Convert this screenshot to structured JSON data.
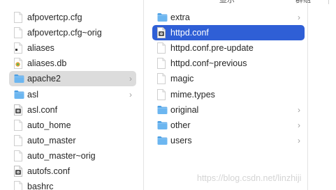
{
  "header": {
    "left_label": "显示",
    "right_label": "群组"
  },
  "left_column": {
    "items": [
      {
        "label": "afpovertcp.cfg",
        "icon": "document-icon",
        "has_children": false
      },
      {
        "label": "afpovertcp.cfg~orig",
        "icon": "document-icon",
        "has_children": false
      },
      {
        "label": "aliases",
        "icon": "executable-document-icon",
        "has_children": false
      },
      {
        "label": "aliases.db",
        "icon": "database-document-icon",
        "has_children": false
      },
      {
        "label": "apache2",
        "icon": "folder-icon",
        "has_children": true,
        "selected": true
      },
      {
        "label": "asl",
        "icon": "folder-icon",
        "has_children": true
      },
      {
        "label": "asl.conf",
        "icon": "config-document-icon",
        "has_children": false
      },
      {
        "label": "auto_home",
        "icon": "document-icon",
        "has_children": false
      },
      {
        "label": "auto_master",
        "icon": "document-icon",
        "has_children": false
      },
      {
        "label": "auto_master~orig",
        "icon": "document-icon",
        "has_children": false
      },
      {
        "label": "autofs.conf",
        "icon": "config-document-icon",
        "has_children": false
      },
      {
        "label": "bashrc",
        "icon": "document-icon",
        "has_children": false
      }
    ]
  },
  "right_column": {
    "items": [
      {
        "label": "extra",
        "icon": "folder-icon",
        "has_children": true
      },
      {
        "label": "httpd.conf",
        "icon": "config-document-icon",
        "has_children": false,
        "selected": true
      },
      {
        "label": "httpd.conf.pre-update",
        "icon": "document-icon",
        "has_children": false
      },
      {
        "label": "httpd.conf~previous",
        "icon": "document-icon",
        "has_children": false
      },
      {
        "label": "magic",
        "icon": "document-icon",
        "has_children": false
      },
      {
        "label": "mime.types",
        "icon": "document-icon",
        "has_children": false
      },
      {
        "label": "original",
        "icon": "folder-icon",
        "has_children": true
      },
      {
        "label": "other",
        "icon": "folder-icon",
        "has_children": true
      },
      {
        "label": "users",
        "icon": "folder-icon",
        "has_children": true
      }
    ]
  },
  "watermark": "https://blog.csdn.net/linzhiji",
  "colors": {
    "selection_blue": "#2f5fd6",
    "selection_gray": "#dcdcdc",
    "folder_blue": "#5aa9e8"
  }
}
